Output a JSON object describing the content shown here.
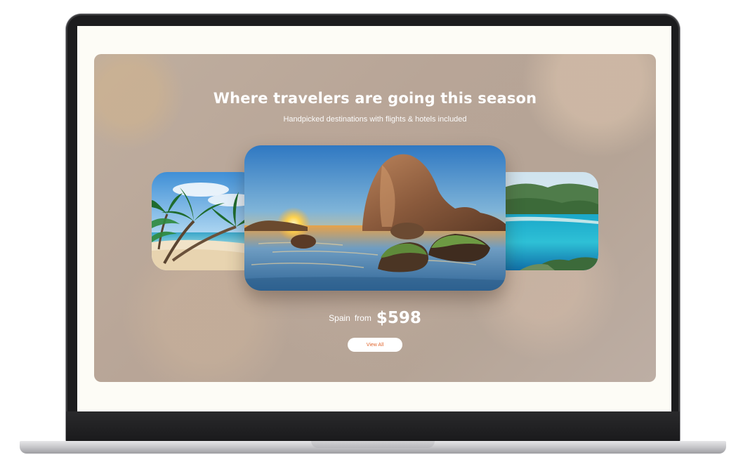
{
  "hero": {
    "title": "Where travelers are going this season",
    "subtitle": "Handpicked destinations with flights & hotels included"
  },
  "carousel": {
    "cards": [
      {
        "scene": "tropical-beach-with-palms"
      },
      {
        "scene": "sunset-sea-stack-rock"
      },
      {
        "scene": "turquoise-lagoon-with-hills"
      }
    ],
    "active_index": 1
  },
  "featured": {
    "destination": "Spain",
    "from_label": "from",
    "price": "$598"
  },
  "cta": {
    "label": "View All"
  },
  "colors": {
    "accent": "#e0662e",
    "hero_background": "#b8a597",
    "screen_background": "#fdfcf6",
    "bezel": "#1c1c1e"
  }
}
